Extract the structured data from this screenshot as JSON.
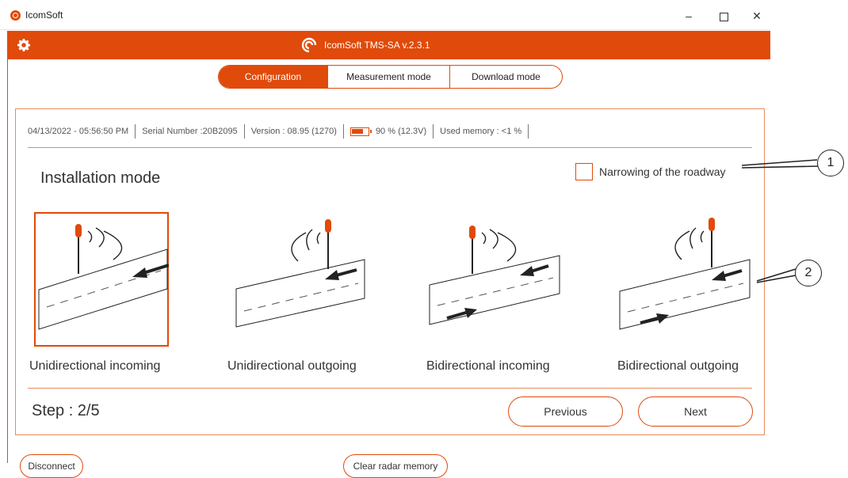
{
  "window": {
    "title": "IcomSoft"
  },
  "header": {
    "app_name": "IcomSoft TMS-SA  v.2.3.1"
  },
  "tabs": [
    {
      "label": "Configuration",
      "active": true
    },
    {
      "label": "Measurement mode",
      "active": false
    },
    {
      "label": "Download mode",
      "active": false
    }
  ],
  "status": {
    "datetime": "04/13/2022 - 05:56:50 PM",
    "serial": "Serial Number :20B2095",
    "version": "Version : 08.95 (1270)",
    "battery": "90 %  (12.3V)",
    "memory": "Used memory : <1 %",
    "battery_level": 0.9
  },
  "installation": {
    "title": "Installation mode",
    "narrowing_label": "Narrowing of the roadway",
    "narrowing_checked": false,
    "options": [
      {
        "label": "Unidirectional incoming",
        "selected": true
      },
      {
        "label": "Unidirectional outgoing",
        "selected": false
      },
      {
        "label": "Bidirectional incoming",
        "selected": false
      },
      {
        "label": "Bidirectional outgoing",
        "selected": false
      }
    ]
  },
  "footer": {
    "step": "Step : 2/5",
    "previous": "Previous",
    "next": "Next"
  },
  "bottom": {
    "disconnect": "Disconnect",
    "clear": "Clear radar memory"
  },
  "callouts": [
    "1",
    "2"
  ],
  "colors": {
    "accent": "#e04a0a",
    "border": "#e88a5c"
  },
  "icons": [
    "app-logo-icon",
    "gear-icon",
    "battery-icon",
    "minimize-icon",
    "maximize-icon",
    "close-icon"
  ]
}
